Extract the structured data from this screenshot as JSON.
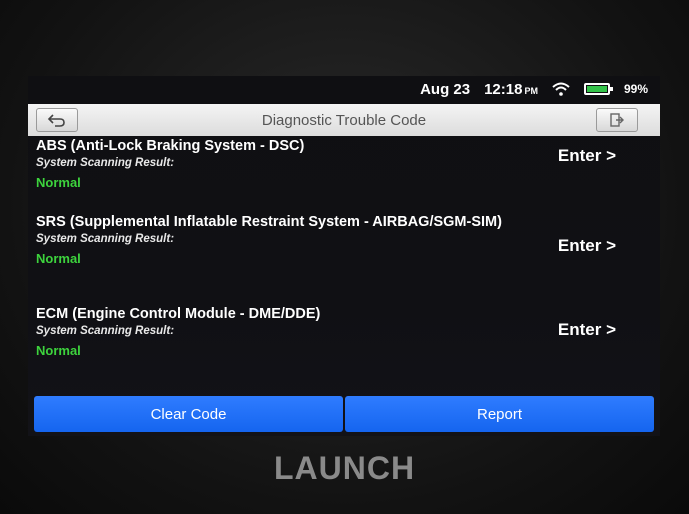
{
  "status": {
    "date": "Aug 23",
    "time": "12:18",
    "ampm": "PM",
    "battery": "99%"
  },
  "header": {
    "title": "Diagnostic Trouble Code"
  },
  "systems": [
    {
      "name": "ABS (Anti-Lock Braking System - DSC)",
      "label": "System Scanning Result:",
      "result": "Normal",
      "enter": "Enter >"
    },
    {
      "name": "SRS (Supplemental Inflatable Restraint System - AIRBAG/SGM-SIM)",
      "label": "System Scanning Result:",
      "result": "Normal",
      "enter": "Enter >"
    },
    {
      "name": "ECM (Engine Control Module - DME/DDE)",
      "label": "System Scanning Result:",
      "result": "Normal",
      "enter": "Enter >"
    }
  ],
  "actions": {
    "clear_code": "Clear Code",
    "report": "Report"
  },
  "brand": "LAUNCH",
  "colors": {
    "accent": "#1f6ff5",
    "normal": "#3dd33d",
    "battery": "#34c34a"
  },
  "icons": {
    "back": "back-arrow-icon",
    "exit": "exit-icon",
    "wifi": "wifi-icon",
    "battery": "battery-icon"
  }
}
